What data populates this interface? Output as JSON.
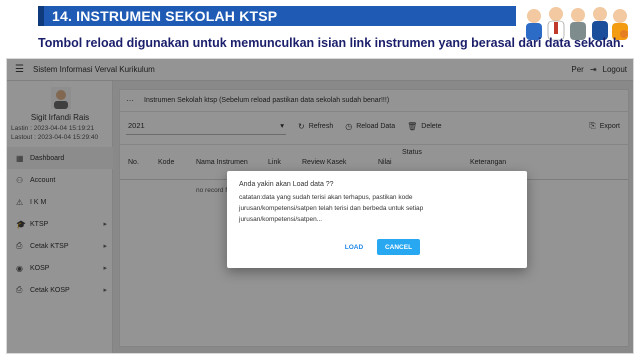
{
  "slide": {
    "title": "14. INSTRUMEN SEKOLAH KTSP",
    "subtitle": "Tombol reload digunakan untuk memunculkan isian link instrumen yang berasal dari data sekolah."
  },
  "topbar": {
    "app_name": "Sistem Informasi Verval Kurikulum",
    "user_short": "Per",
    "logout_label": "Logout"
  },
  "sidebar": {
    "user_name": "Sigit Irfandi Rais",
    "lastin": "Lastin : 2023-04-04 15:19:21",
    "lastout": "Lastout : 2023-04-04 15:29:40",
    "items": [
      {
        "label": "Dashboard",
        "icon": "dashboard-icon",
        "glyph": "▦",
        "chevron": ""
      },
      {
        "label": "Account",
        "icon": "person-icon",
        "glyph": "⚇",
        "chevron": ""
      },
      {
        "label": "I K M",
        "icon": "warning-icon",
        "glyph": "⚠",
        "chevron": ""
      },
      {
        "label": "KTSP",
        "icon": "school-icon",
        "glyph": "🎓",
        "chevron": "▸"
      },
      {
        "label": "Cetak KTSP",
        "icon": "print-icon",
        "glyph": "⎙",
        "chevron": "▸"
      },
      {
        "label": "KOSP",
        "icon": "eye-icon",
        "glyph": "◉",
        "chevron": "▸"
      },
      {
        "label": "Cetak KOSP",
        "icon": "print-icon",
        "glyph": "⎙",
        "chevron": "▸"
      }
    ]
  },
  "card": {
    "header": "Instrumen Sekolah ktsp (Sebelum reload pastikan data sekolah sudah benar!!!)",
    "year_value": "2021",
    "buttons": {
      "refresh": "Refresh",
      "reload": "Reload Data",
      "delete": "Delete",
      "export": "Export"
    },
    "columns": [
      "No.",
      "Kode",
      "Nama Instrumen",
      "Link",
      "Review Kasek",
      "Nilai",
      "Status",
      "Keterangan"
    ],
    "empty_text": "no record fo"
  },
  "dialog": {
    "title": "Anda yakin akan Load data ??",
    "message": "catatan:data yang sudah terisi akan terhapus, pastikan kode jurusan/kompetensi/satpen telah terisi dan berbeda untuk setiap jurusan/kompetensi/satpen...",
    "load_label": "LOAD",
    "cancel_label": "CANCEL"
  },
  "colors": {
    "title_bar": "#1f5bb5",
    "subtitle": "#1b1f6b",
    "cancel_button": "#29a8f2",
    "load_text": "#1e88e5"
  }
}
